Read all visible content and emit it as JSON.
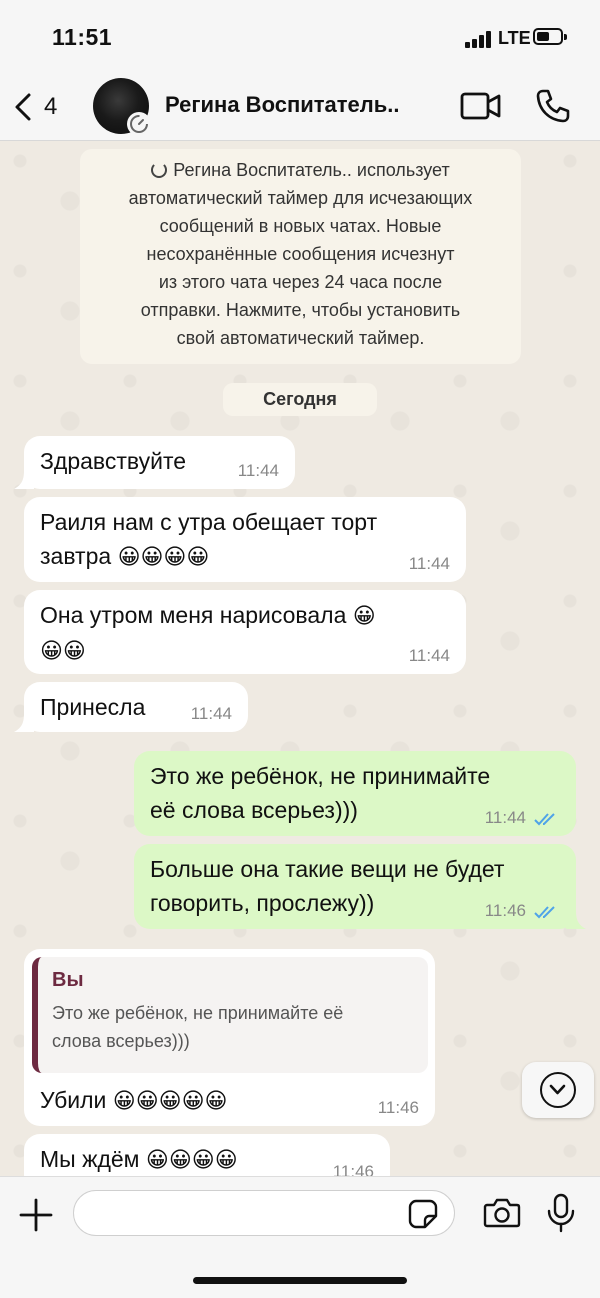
{
  "status_bar": {
    "time": "11:51",
    "network": "LTE"
  },
  "header": {
    "back_count": "4",
    "contact_name": "Регина Воспитатель..",
    "icons": [
      "chevron-left-icon",
      "video-call-icon",
      "phone-icon",
      "disappearing-timer-icon"
    ]
  },
  "system_message": {
    "line1": "Регина Воспитатель.. использует",
    "line2": "автоматический таймер для исчезающих",
    "line3": "сообщений в новых чатах. Новые",
    "line4": "несохранённые сообщения исчезнут",
    "line5": "из этого чата через 24 часа после",
    "line6": "отправки. Нажмите, чтобы установить",
    "line7": "свой автоматический таймер."
  },
  "date_separator": "Сегодня",
  "messages": [
    {
      "direction": "in",
      "text": "Здравствуйте",
      "time": "11:44"
    },
    {
      "direction": "in",
      "text_line1": "Раиля нам с утра обещает торт",
      "text_line2": "завтра",
      "emoji": "😀😀😀😀",
      "time": "11:44"
    },
    {
      "direction": "in",
      "text_line1": "Она утром меня нарисовала",
      "emoji1": "😀",
      "emoji2": "😀😀",
      "time": "11:44"
    },
    {
      "direction": "in",
      "text": "Принесла",
      "time": "11:44"
    },
    {
      "direction": "out",
      "text_line1": "Это же ребёнок, не принимайте",
      "text_line2": "её слова всерьез)))",
      "time": "11:44",
      "status": "read"
    },
    {
      "direction": "out",
      "text_line1": "Больше она такие вещи не будет",
      "text_line2": "говорить, прослежу))",
      "time": "11:46",
      "status": "read"
    },
    {
      "direction": "in",
      "quote_author": "Вы",
      "quote_line1": "Это же ребёнок, не принимайте её",
      "quote_line2": "слова всерьез)))",
      "text": "Убили",
      "emoji": "😀😀😀😀😀",
      "time": "11:46"
    },
    {
      "direction": "in",
      "text": "Мы ждём",
      "emoji": "😀😀😀😀",
      "time": "11:46"
    }
  ],
  "composer": {
    "input_value": "",
    "placeholder": ""
  },
  "colors": {
    "incoming_bubble": "#ffffff",
    "outgoing_bubble": "#dcf8c6",
    "read_ticks": "#4fa3e8",
    "quote_accent": "#6d2a41"
  }
}
